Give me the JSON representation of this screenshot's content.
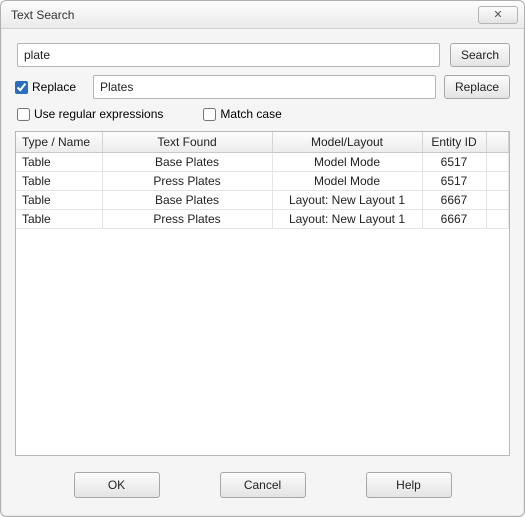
{
  "window": {
    "title": "Text Search"
  },
  "search": {
    "value": "plate",
    "button": "Search"
  },
  "replace": {
    "checkbox_label": "Replace",
    "checked": true,
    "value": "Plates",
    "button": "Replace"
  },
  "options": {
    "regex_label": "Use regular expressions",
    "regex_checked": false,
    "matchcase_label": "Match case",
    "matchcase_checked": false
  },
  "table": {
    "headers": {
      "type": "Type / Name",
      "text": "Text Found",
      "model": "Model/Layout",
      "entity": "Entity ID"
    },
    "rows": [
      {
        "type": "Table",
        "text": "Base Plates",
        "model": "Model Mode",
        "entity": "6517"
      },
      {
        "type": "Table",
        "text": "Press Plates",
        "model": "Model Mode",
        "entity": "6517"
      },
      {
        "type": "Table",
        "text": "Base Plates",
        "model": "Layout: New Layout 1",
        "entity": "6667"
      },
      {
        "type": "Table",
        "text": "Press Plates",
        "model": "Layout: New Layout 1",
        "entity": "6667"
      }
    ]
  },
  "buttons": {
    "ok": "OK",
    "cancel": "Cancel",
    "help": "Help"
  },
  "icons": {
    "close_glyph": "✕"
  }
}
